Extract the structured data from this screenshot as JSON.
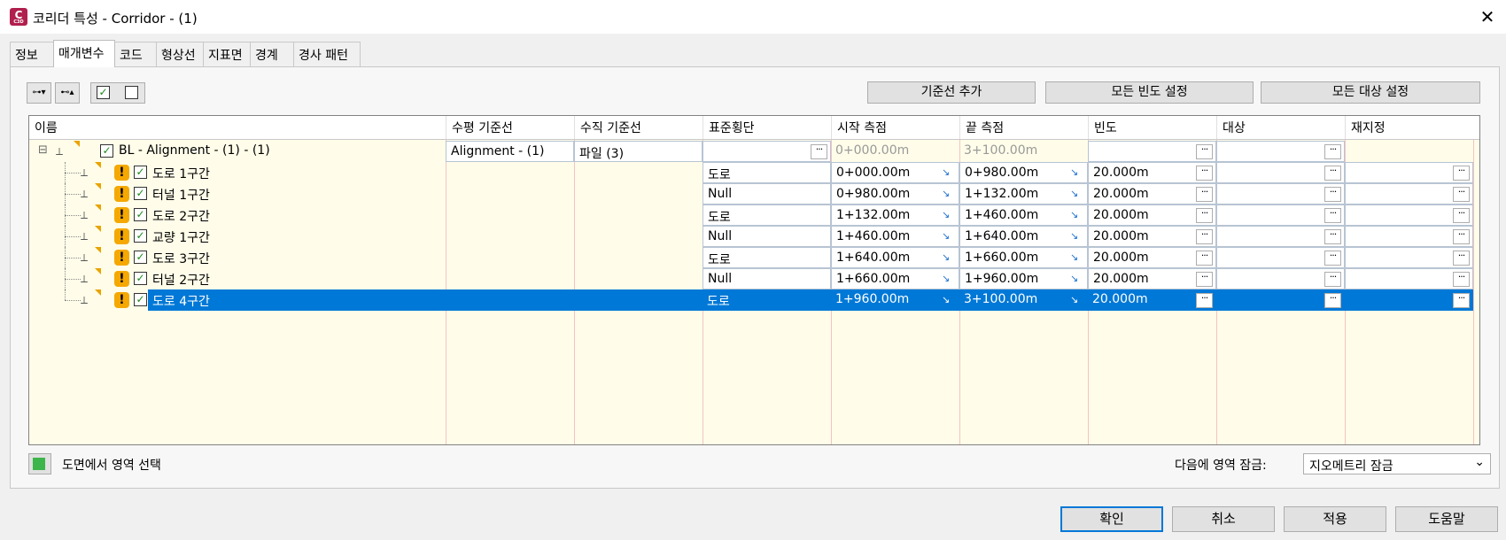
{
  "window": {
    "title": "코리더 특성 - Corridor - (1)",
    "app_icon": "C",
    "app_icon_sub": "C3D",
    "close": "✕"
  },
  "tabs": [
    {
      "label": "정보"
    },
    {
      "label": "매개변수"
    },
    {
      "label": "코드"
    },
    {
      "label": "형상선"
    },
    {
      "label": "지표면"
    },
    {
      "label": "경계"
    },
    {
      "label": "경사 패턴"
    }
  ],
  "toolbar": {
    "add_baseline": "기준선 추가",
    "set_all_frequencies": "모든 빈도 설정",
    "set_all_targets": "모든 대상 설정",
    "expand_icon": "⊶▾",
    "collapse_icon": "⊷▴",
    "check_all": "✓",
    "uncheck_all": ""
  },
  "columns": [
    "이름",
    "수평 기준선",
    "수직 기준선",
    "표준횡단",
    "시작 측점",
    "끝 측점",
    "빈도",
    "대상",
    "재지정"
  ],
  "baseline": {
    "expand": "⊟",
    "name": "BL - Alignment - (1) - (1)",
    "horizontal": "Alignment - (1)",
    "vertical": "파일 (3)",
    "start": "0+000.00m",
    "end": "3+100.00m"
  },
  "regions": [
    {
      "name": "도로 1구간",
      "assembly": "도로",
      "start": "0+000.00m",
      "end": "0+980.00m",
      "frequency": "20.000m"
    },
    {
      "name": "터널 1구간",
      "assembly": "Null",
      "start": "0+980.00m",
      "end": "1+132.00m",
      "frequency": "20.000m"
    },
    {
      "name": "도로 2구간",
      "assembly": "도로",
      "start": "1+132.00m",
      "end": "1+460.00m",
      "frequency": "20.000m"
    },
    {
      "name": "교량 1구간",
      "assembly": "Null",
      "start": "1+460.00m",
      "end": "1+640.00m",
      "frequency": "20.000m"
    },
    {
      "name": "도로 3구간",
      "assembly": "도로",
      "start": "1+640.00m",
      "end": "1+660.00m",
      "frequency": "20.000m"
    },
    {
      "name": "터널 2구간",
      "assembly": "Null",
      "start": "1+660.00m",
      "end": "1+960.00m",
      "frequency": "20.000m"
    },
    {
      "name": "도로 4구간",
      "assembly": "도로",
      "start": "1+960.00m",
      "end": "3+100.00m",
      "frequency": "20.000m"
    }
  ],
  "selected_row": 6,
  "ellipsis": "···",
  "check": "✓",
  "warning": "!",
  "bottom": {
    "select_region_label": "도면에서 영역 선택",
    "lock_label": "다음에 영역 잠금:",
    "lock_value": "지오메트리 잠금",
    "dropdown_arrow": "⌄"
  },
  "footer": {
    "ok": "확인",
    "cancel": "취소",
    "apply": "적용",
    "help": "도움말"
  },
  "colors": {
    "selection": "#0078d7",
    "grid_bg": "#fffde9",
    "warning": "#f5a800",
    "app_icon": "#b01f4e"
  }
}
